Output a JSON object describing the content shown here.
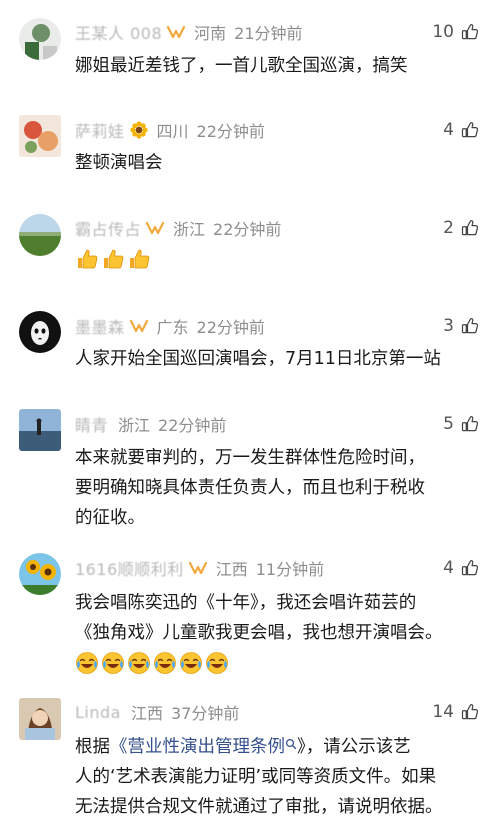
{
  "comments": [
    {
      "username": "王某人 008",
      "has_vip_badge": true,
      "location": "河南",
      "time": "21分钟前",
      "likes": "10",
      "text_lines": [
        "娜姐最近差钱了，一首儿歌全国巡演，搞笑"
      ]
    },
    {
      "username": "萨莉娃",
      "has_sunflower_badge": true,
      "location": "四川",
      "time": "22分钟前",
      "likes": "4",
      "text_lines": [
        "整顿演唱会"
      ]
    },
    {
      "username": "霸占传占",
      "has_vip_badge": true,
      "location": "浙江",
      "time": "22分钟前",
      "likes": "2",
      "emoji": [
        "thumbs-up",
        "thumbs-up",
        "thumbs-up"
      ]
    },
    {
      "username": "墨墨森",
      "has_vip_badge": true,
      "location": "广东",
      "time": "22分钟前",
      "likes": "3",
      "text_lines": [
        "人家开始全国巡回演唱会，7月11日北京第一站"
      ]
    },
    {
      "username": "睛青",
      "location": "浙江",
      "time": "22分钟前",
      "likes": "5",
      "text_lines": [
        "本来就要审判的，万一发生群体性危险时间，",
        "要明确知晓具体责任负责人，而且也利于税收",
        "的征收。"
      ]
    },
    {
      "username": "1616顺顺利利",
      "has_vip_badge": true,
      "location": "江西",
      "time": "11分钟前",
      "likes": "4",
      "text_lines": [
        "我会唱陈奕迅的《十年》，我还会唱许茹芸的",
        "《独角戏》儿童歌我更会唱，我也想开演唱会。"
      ],
      "emoji": [
        "laugh-cry",
        "laugh-cry",
        "laugh-cry",
        "laugh-cry",
        "laugh-cry",
        "laugh-cry"
      ]
    },
    {
      "username": "Linda",
      "location": "江西",
      "time": "37分钟前",
      "likes": "14",
      "text_lines": {
        "l1_prefix": "根据",
        "l1_link": "《营业性演出管理条例",
        "l1_suffix": "》，请公示该艺",
        "l2": "人的‘艺术表演能力证明’或同等资质文件。如果",
        "l3": "无法提供合规文件就通过了审批，请说明依据。"
      }
    }
  ],
  "colors": {
    "vip_orange": "#f2a93b",
    "meta_gray": "#8e8e8e",
    "link_blue": "#35508e"
  }
}
